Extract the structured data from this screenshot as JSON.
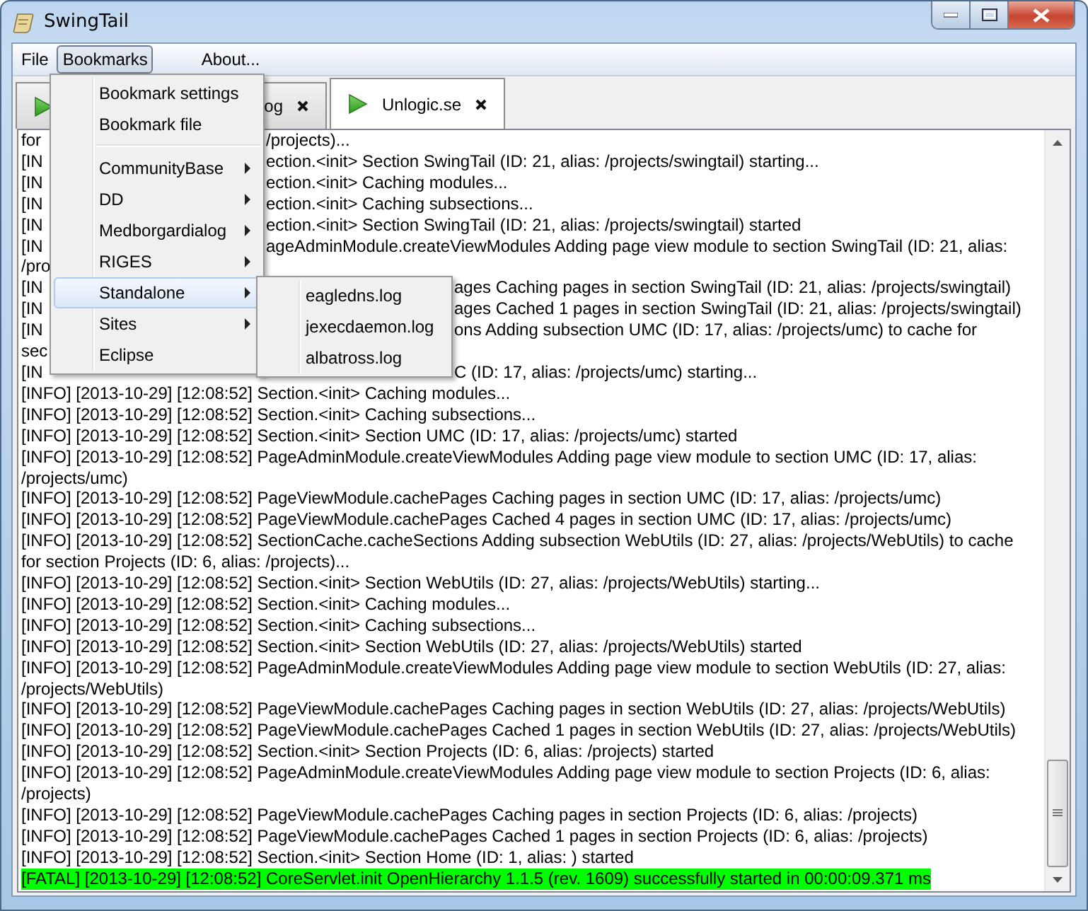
{
  "window": {
    "title": "SwingTail"
  },
  "menubar": [
    {
      "label": "File",
      "selected": false
    },
    {
      "label": "Bookmarks",
      "selected": true
    },
    {
      "label": "About...",
      "selected": false
    }
  ],
  "tabs": [
    {
      "label": "og",
      "selected": false
    },
    {
      "label": "Unlogic.se",
      "selected": true
    }
  ],
  "bookmarks_menu": [
    {
      "kind": "item",
      "label": "Bookmark settings",
      "selected": false
    },
    {
      "kind": "item",
      "label": "Bookmark file",
      "selected": false
    },
    {
      "kind": "separator"
    },
    {
      "kind": "submenu",
      "label": "CommunityBase",
      "selected": false
    },
    {
      "kind": "submenu",
      "label": "DD",
      "selected": false
    },
    {
      "kind": "submenu",
      "label": "Medborgardialog",
      "selected": false
    },
    {
      "kind": "submenu",
      "label": "RIGES",
      "selected": false
    },
    {
      "kind": "submenu",
      "label": "Standalone",
      "selected": true
    },
    {
      "kind": "submenu",
      "label": "Sites",
      "selected": false
    },
    {
      "kind": "item",
      "label": "Eclipse",
      "selected": false
    }
  ],
  "standalone_submenu": [
    {
      "label": "eagledns.log",
      "selected": false
    },
    {
      "label": "jexecdaemon.log",
      "selected": false
    },
    {
      "label": "albatross.log",
      "selected": false
    }
  ],
  "log": [
    {
      "kind": "info",
      "under_menu": true,
      "lead": "for",
      "tail": "/projects)..."
    },
    {
      "kind": "info",
      "under_menu": true,
      "lead": "[IN",
      "tail": "ection.<init> Section SwingTail (ID: 21, alias: /projects/swingtail) starting..."
    },
    {
      "kind": "info",
      "under_menu": true,
      "lead": "[IN",
      "tail": "ection.<init> Caching modules..."
    },
    {
      "kind": "info",
      "under_menu": true,
      "lead": "[IN",
      "tail": "ection.<init> Caching subsections..."
    },
    {
      "kind": "info",
      "under_menu": true,
      "lead": "[IN",
      "tail": "ection.<init> Section SwingTail (ID: 21, alias: /projects/swingtail) started"
    },
    {
      "kind": "info",
      "under_menu": true,
      "lead": "[IN",
      "tail": "ageAdminModule.createViewModules Adding page view module to section SwingTail (ID: 21, alias:"
    },
    {
      "kind": "info",
      "under_menu": true,
      "lead": "/pro"
    },
    {
      "kind": "info",
      "under_submenu": true,
      "lead": "[IN",
      "tail": "ages Caching pages in section SwingTail (ID: 21, alias: /projects/swingtail)"
    },
    {
      "kind": "info",
      "under_submenu": true,
      "lead": "[IN",
      "tail": "ages Cached 1 pages in section SwingTail (ID: 21, alias: /projects/swingtail)"
    },
    {
      "kind": "info",
      "under_submenu": true,
      "lead": "[IN",
      "tail": "ons Adding subsection UMC (ID: 17, alias: /projects/umc) to cache for"
    },
    {
      "kind": "info",
      "under_submenu": true,
      "lead": "sec"
    },
    {
      "kind": "info",
      "under_submenu": true,
      "lead": "[IN",
      "tail": "C (ID: 17, alias: /projects/umc) starting..."
    },
    {
      "kind": "info",
      "text": "[INFO] [2013-10-29] [12:08:52] Section.<init> Caching modules..."
    },
    {
      "kind": "info",
      "text": "[INFO] [2013-10-29] [12:08:52] Section.<init> Caching subsections..."
    },
    {
      "kind": "info",
      "text": "[INFO] [2013-10-29] [12:08:52] Section.<init> Section UMC (ID: 17, alias: /projects/umc) started"
    },
    {
      "kind": "info",
      "text": "[INFO] [2013-10-29] [12:08:52] PageAdminModule.createViewModules Adding page view module to section UMC (ID: 17, alias:"
    },
    {
      "kind": "info",
      "text": "/projects/umc)"
    },
    {
      "kind": "info",
      "text": "[INFO] [2013-10-29] [12:08:52] PageViewModule.cachePages Caching pages in section UMC (ID: 17, alias: /projects/umc)"
    },
    {
      "kind": "info",
      "text": "[INFO] [2013-10-29] [12:08:52] PageViewModule.cachePages Cached 4 pages in section UMC (ID: 17, alias: /projects/umc)"
    },
    {
      "kind": "info",
      "text": "[INFO] [2013-10-29] [12:08:52] SectionCache.cacheSections Adding subsection WebUtils (ID: 27, alias: /projects/WebUtils) to cache"
    },
    {
      "kind": "info",
      "text": "for section Projects (ID: 6, alias: /projects)..."
    },
    {
      "kind": "info",
      "text": "[INFO] [2013-10-29] [12:08:52] Section.<init> Section WebUtils (ID: 27, alias: /projects/WebUtils) starting..."
    },
    {
      "kind": "info",
      "text": "[INFO] [2013-10-29] [12:08:52] Section.<init> Caching modules..."
    },
    {
      "kind": "info",
      "text": "[INFO] [2013-10-29] [12:08:52] Section.<init> Caching subsections..."
    },
    {
      "kind": "info",
      "text": "[INFO] [2013-10-29] [12:08:52] Section.<init> Section WebUtils (ID: 27, alias: /projects/WebUtils) started"
    },
    {
      "kind": "info",
      "text": "[INFO] [2013-10-29] [12:08:52] PageAdminModule.createViewModules Adding page view module to section WebUtils (ID: 27, alias:"
    },
    {
      "kind": "info",
      "text": "/projects/WebUtils)"
    },
    {
      "kind": "info",
      "text": "[INFO] [2013-10-29] [12:08:52] PageViewModule.cachePages Caching pages in section WebUtils (ID: 27, alias: /projects/WebUtils)"
    },
    {
      "kind": "info",
      "text": "[INFO] [2013-10-29] [12:08:52] PageViewModule.cachePages Cached 1 pages in section WebUtils (ID: 27, alias: /projects/WebUtils)"
    },
    {
      "kind": "info",
      "text": "[INFO] [2013-10-29] [12:08:52] Section.<init> Section Projects (ID: 6, alias: /projects) started"
    },
    {
      "kind": "info",
      "text": "[INFO] [2013-10-29] [12:08:52] PageAdminModule.createViewModules Adding page view module to section Projects (ID: 6, alias:"
    },
    {
      "kind": "info",
      "text": "/projects)"
    },
    {
      "kind": "info",
      "text": "[INFO] [2013-10-29] [12:08:52] PageViewModule.cachePages Caching pages in section Projects (ID: 6, alias: /projects)"
    },
    {
      "kind": "info",
      "text": "[INFO] [2013-10-29] [12:08:52] PageViewModule.cachePages Cached 1 pages in section Projects (ID: 6, alias: /projects)"
    },
    {
      "kind": "info",
      "text": "[INFO] [2013-10-29] [12:08:52] Section.<init> Section Home (ID: 1, alias: ) started"
    },
    {
      "kind": "fatal",
      "text": "[FATAL] [2013-10-29] [12:08:52] CoreServlet.init OpenHierarchy 1.1.5 (rev. 1609) successfully started in 00:00:09.371 ms"
    }
  ]
}
